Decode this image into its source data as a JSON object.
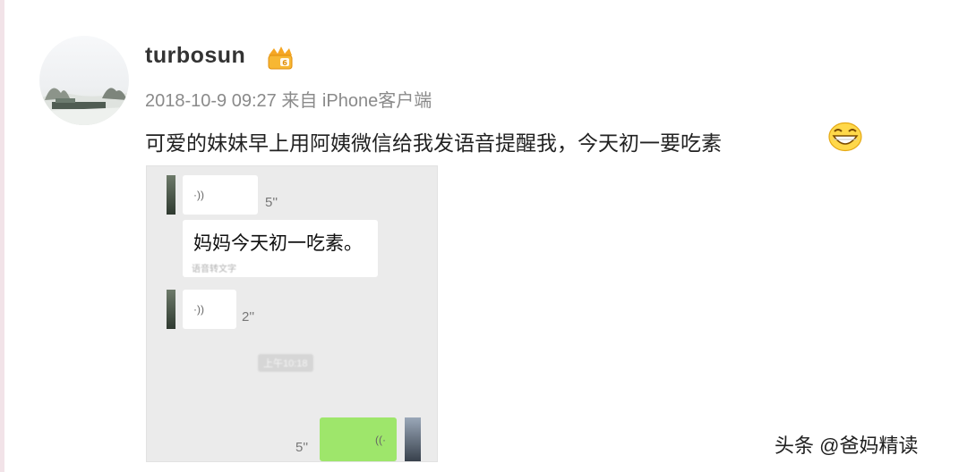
{
  "post": {
    "username": "turbosun",
    "timestamp": "2018-10-9 09:27",
    "source": "来自 iPhone客户端",
    "text": "可爱的妹妹早上用阿姨微信给我发语音提醒我，今天初一要吃素"
  },
  "icons": {
    "avatar": "snowy-landscape-avatar",
    "badge": "vip-crown-icon",
    "emoji": "grinning-face-icon",
    "voice": "voice-wave-icon"
  },
  "screenshot": {
    "voice_1_duration": "5''",
    "text_message": "妈妈今天初一吃素。",
    "text_message_sub": "语音转文字",
    "voice_2_duration": "2''",
    "time_divider": "上午10:18",
    "voice_3_duration": "5''",
    "voice_symbol": "·))"
  },
  "watermark": "头条 @爸妈精读",
  "colors": {
    "username": "#333333",
    "meta": "#8a8a8a",
    "wechat_green": "#9ee66b",
    "chat_bg": "#ebebeb"
  }
}
